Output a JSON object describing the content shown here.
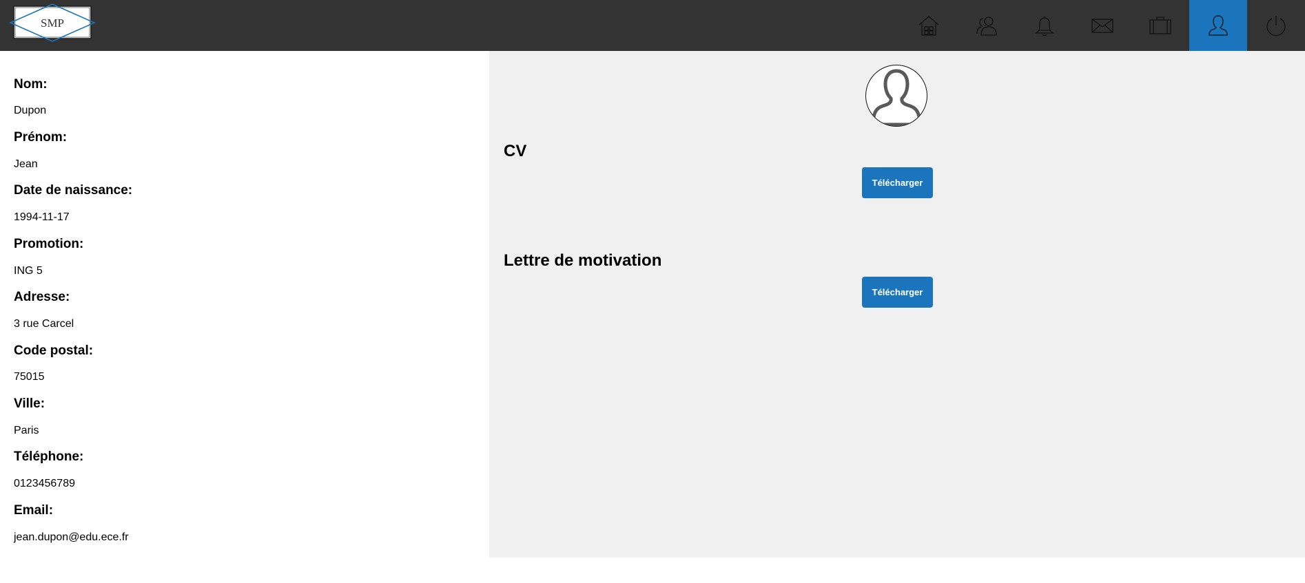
{
  "brand": {
    "logo_text": "SMP"
  },
  "nav": {
    "items": [
      {
        "name": "home",
        "icon": "home-icon"
      },
      {
        "name": "network",
        "icon": "users-icon"
      },
      {
        "name": "notifications",
        "icon": "bell-icon"
      },
      {
        "name": "messages",
        "icon": "mail-icon"
      },
      {
        "name": "jobs",
        "icon": "briefcase-icon"
      },
      {
        "name": "profile",
        "icon": "user-icon",
        "active": true
      },
      {
        "name": "logout",
        "icon": "power-icon"
      }
    ],
    "active_color": "#1b75bc",
    "bar_color": "#333333"
  },
  "profile": {
    "fields": [
      {
        "label": "Nom:",
        "value": "Dupon"
      },
      {
        "label": "Prénom:",
        "value": "Jean"
      },
      {
        "label": "Date de naissance:",
        "value": "1994-11-17"
      },
      {
        "label": "Promotion:",
        "value": "ING 5"
      },
      {
        "label": "Adresse:",
        "value": "3 rue Carcel"
      },
      {
        "label": "Code postal:",
        "value": "75015"
      },
      {
        "label": "Ville:",
        "value": "Paris"
      },
      {
        "label": "Téléphone:",
        "value": "0123456789"
      },
      {
        "label": "Email:",
        "value": "jean.dupon@edu.ece.fr"
      }
    ]
  },
  "documents": {
    "cv_title": "CV",
    "cv_button": "Télécharger",
    "letter_title": "Lettre de motivation",
    "letter_button": "Télécharger"
  }
}
